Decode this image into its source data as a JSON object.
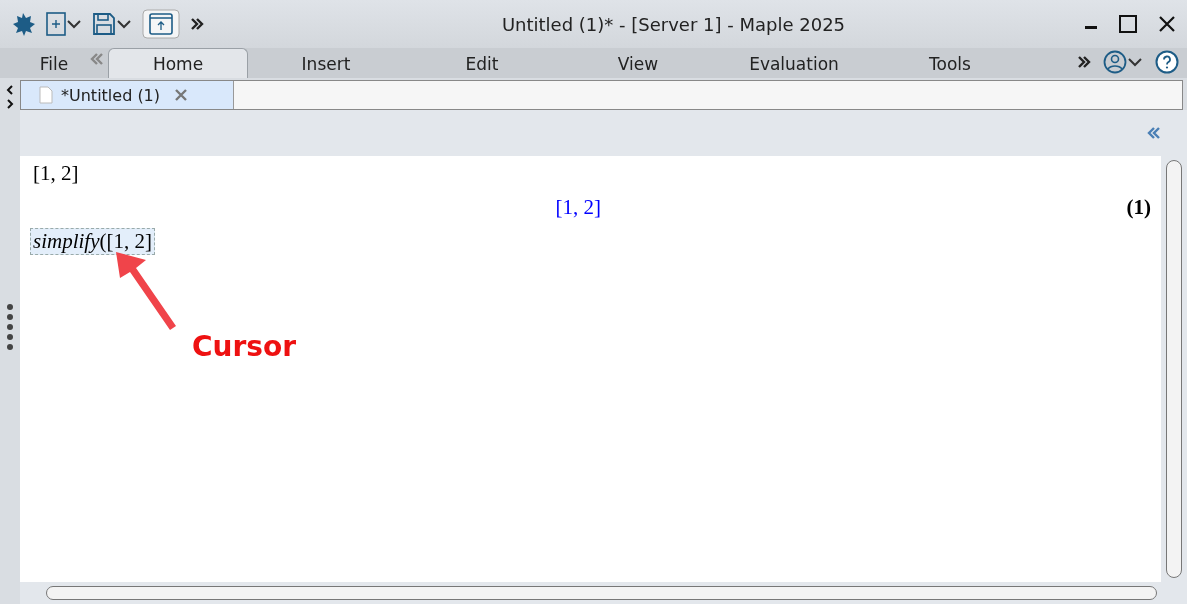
{
  "window": {
    "title": "Untitled (1)* - [Server 1] - Maple 2025"
  },
  "ribbon_tabs": [
    {
      "label": "File",
      "selected": false
    },
    {
      "label": "Home",
      "selected": true
    },
    {
      "label": "Insert",
      "selected": false
    },
    {
      "label": "Edit",
      "selected": false
    },
    {
      "label": "View",
      "selected": false
    },
    {
      "label": "Evaluation",
      "selected": false
    },
    {
      "label": "Tools",
      "selected": false
    }
  ],
  "document_tabs": [
    {
      "label": "*Untitled (1)",
      "selected": true
    }
  ],
  "worksheet": {
    "lines": [
      {
        "kind": "input",
        "text": "[1, 2]"
      },
      {
        "kind": "output",
        "text": "[1, 2]",
        "label": "(1)"
      },
      {
        "kind": "input",
        "text": "*simplify*([1, 2]",
        "active": true
      }
    ]
  },
  "annotation": {
    "text": "Cursor"
  }
}
